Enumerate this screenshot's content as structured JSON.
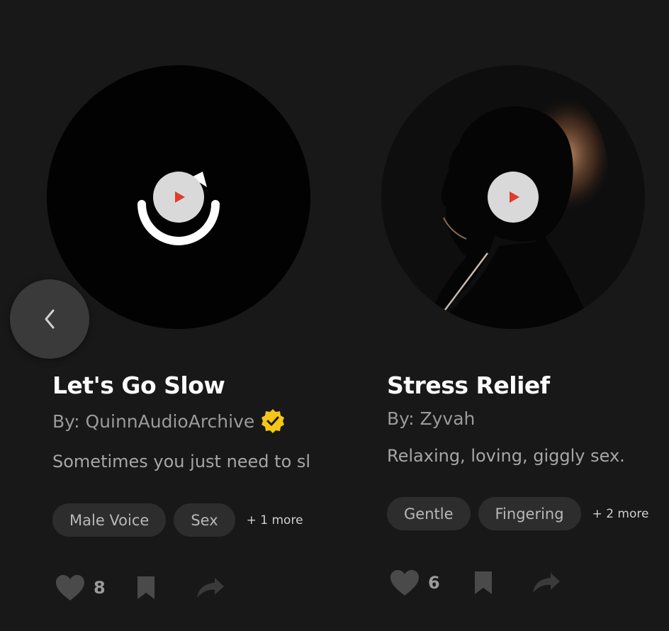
{
  "cards": [
    {
      "title": "Let's Go Slow",
      "author": "By: QuinnAudioArchive",
      "verified": true,
      "description": "Sometimes you just need to sl",
      "tags": [
        "Male Voice",
        "Sex"
      ],
      "more": "+ 1 more",
      "likes": "8"
    },
    {
      "title": "Stress Relief",
      "author": "By: Zyvah",
      "verified": false,
      "description": "Relaxing, loving, giggly sex.",
      "tags": [
        "Gentle",
        "Fingering"
      ],
      "more": "+ 2 more",
      "likes": "6"
    }
  ],
  "icons": {
    "play": "play-icon",
    "back": "chevron-left-icon",
    "like": "heart-icon",
    "save": "bookmark-icon",
    "share": "share-icon",
    "verified": "verified-badge-icon"
  },
  "colors": {
    "background": "#181818",
    "play_accent": "#e23b2b",
    "verified": "#f5c518",
    "tag_bg": "#2d2d2d"
  }
}
